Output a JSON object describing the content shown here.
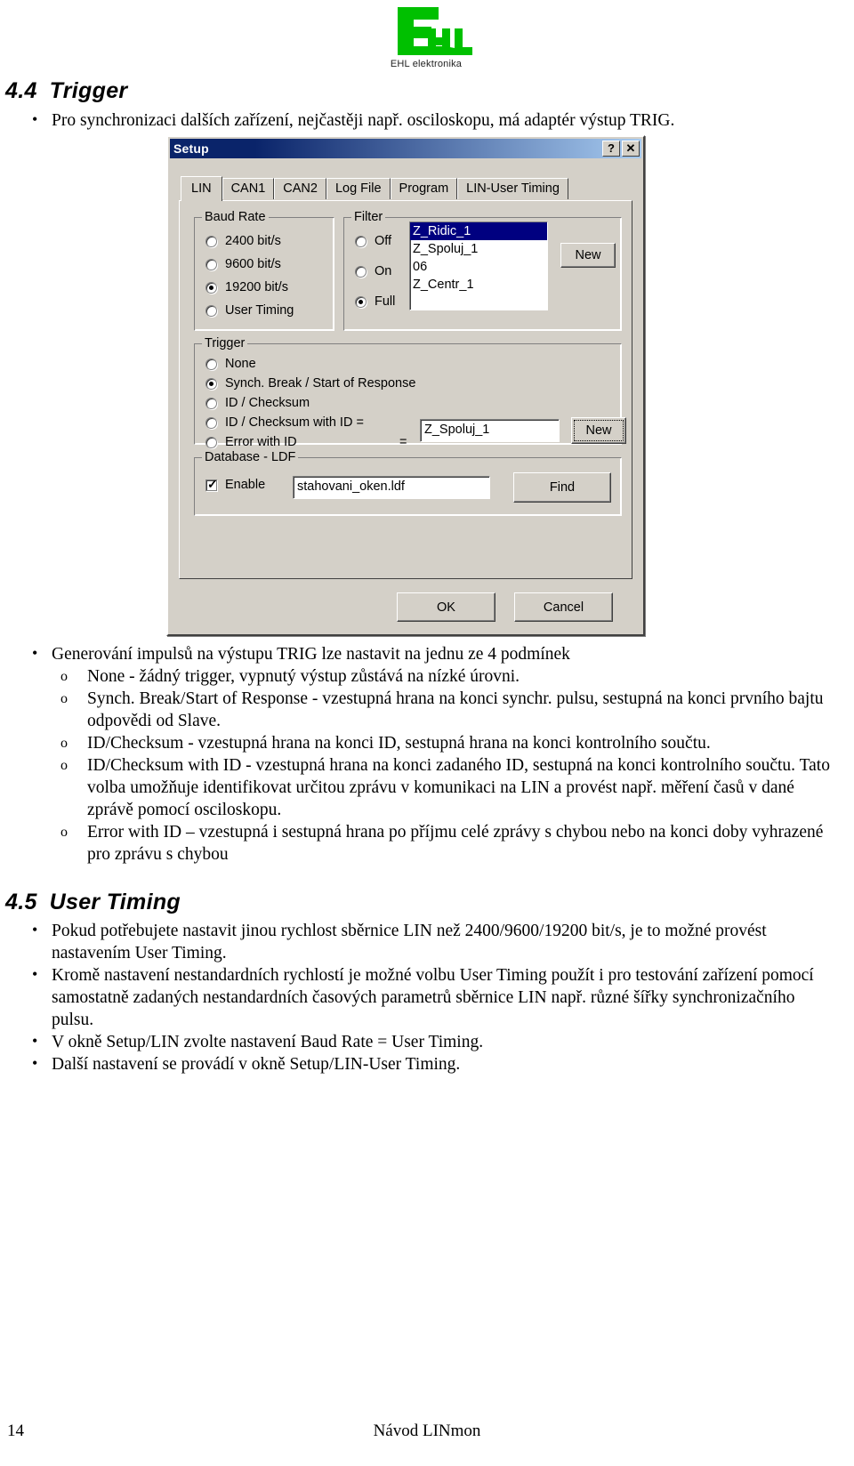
{
  "logo": {
    "mark_text": "EHL",
    "caption": "EHL elektronika",
    "color": "#00c000"
  },
  "sections": {
    "trigger": {
      "number": "4.4",
      "title": "Trigger",
      "intro_bullet": "Pro synchronizaci dalších zařízení, nejčastěji např. osciloskopu, má adaptér výstup TRIG."
    },
    "user_timing": {
      "number": "4.5",
      "title": "User Timing"
    }
  },
  "trigger_notes": {
    "lead": "Generování impulsů na výstupu TRIG lze nastavit na jednu ze 4 podmínek",
    "items": [
      "None - žádný trigger, vypnutý výstup zůstává na nízké úrovni.",
      "Synch. Break/Start of Response - vzestupná hrana na konci synchr. pulsu, sestupná na konci prvního bajtu odpovědi od Slave.",
      "ID/Checksum - vzestupná hrana na konci ID, sestupná hrana na konci kontrolního součtu.",
      "ID/Checksum with ID - vzestupná hrana na konci zadaného ID, sestupná na konci kontrolního součtu. Tato volba umožňuje identifikovat určitou zprávu v komunikaci na LIN a provést např. měření časů v dané zprávě pomocí osciloskopu.",
      "Error with ID – vzestupná i sestupná hrana po příjmu celé zprávy s chybou nebo na konci doby vyhrazené pro zprávu s chybou"
    ]
  },
  "user_timing_notes": {
    "items": [
      "Pokud potřebujete nastavit jinou rychlost sběrnice LIN než 2400/9600/19200 bit/s, je to možné provést nastavením User Timing.",
      "Kromě nastavení nestandardních rychlostí je možné volbu User Timing použít i pro testování zařízení pomocí samostatně zadaných nestandardních časových parametrů sběrnice LIN např. různé šířky synchronizačního pulsu.",
      "V okně Setup/LIN zvolte nastavení Baud Rate = User Timing.",
      "Další nastavení se provádí v okně Setup/LIN-User Timing."
    ]
  },
  "dialog": {
    "title": "Setup",
    "help_button": "?",
    "close_button": "✕",
    "tabs": [
      {
        "label": "LIN",
        "active": true
      },
      {
        "label": "CAN1",
        "active": false
      },
      {
        "label": "CAN2",
        "active": false
      },
      {
        "label": "Log File",
        "active": false
      },
      {
        "label": "Program",
        "active": false
      },
      {
        "label": "LIN-User Timing",
        "active": false
      }
    ],
    "baud_rate": {
      "legend": "Baud Rate",
      "options": [
        {
          "label": "2400 bit/s",
          "selected": false
        },
        {
          "label": "9600 bit/s",
          "selected": false
        },
        {
          "label": "19200 bit/s",
          "selected": true
        },
        {
          "label": "User Timing",
          "selected": false
        }
      ]
    },
    "filter": {
      "legend": "Filter",
      "options": [
        {
          "label": "Off",
          "selected": false
        },
        {
          "label": "On",
          "selected": false
        },
        {
          "label": "Full",
          "selected": true
        }
      ],
      "list_items": [
        {
          "label": "Z_Ridic_1",
          "selected": true
        },
        {
          "label": "Z_Spoluj_1",
          "selected": false
        },
        {
          "label": "06",
          "selected": false
        },
        {
          "label": "Z_Centr_1",
          "selected": false
        }
      ],
      "new_button": "New"
    },
    "trigger": {
      "legend": "Trigger",
      "options": [
        {
          "label": "None",
          "selected": false
        },
        {
          "label": "Synch. Break / Start of Response",
          "selected": true
        },
        {
          "label": "ID / Checksum",
          "selected": false
        },
        {
          "label": "ID / Checksum with ID =",
          "selected": false
        },
        {
          "label": "Error with ID",
          "selected": false
        }
      ],
      "equals_sign": "=",
      "id_value": "Z_Spoluj_1",
      "new_button": "New"
    },
    "database": {
      "legend": "Database - LDF",
      "enable_label": "Enable",
      "enable_checked": true,
      "file_value": "stahovani_oken.ldf",
      "find_button": "Find"
    },
    "ok_button": "OK",
    "cancel_button": "Cancel"
  },
  "footer": {
    "page_number": "14",
    "document_title": "Návod LINmon"
  }
}
